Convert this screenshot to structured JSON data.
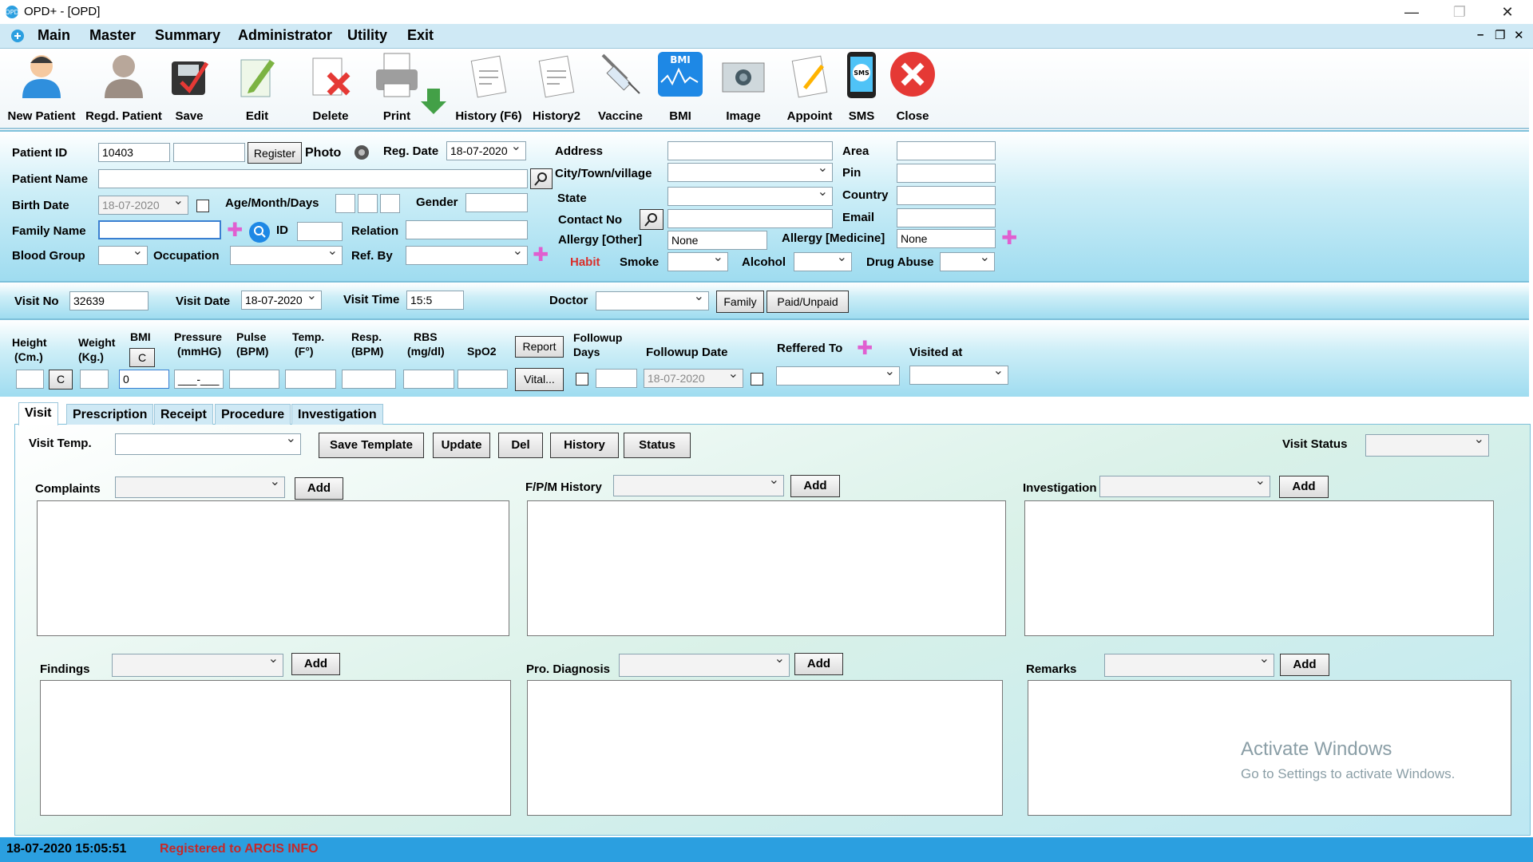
{
  "window": {
    "title": "OPD+ - [OPD]"
  },
  "menu": [
    "Main",
    "Master",
    "Summary",
    "Administrator",
    "Utility",
    "Exit"
  ],
  "toolbar": [
    {
      "label": "New Patient",
      "icon": "new-patient-icon"
    },
    {
      "label": "Regd. Patient",
      "icon": "registered-patient-icon"
    },
    {
      "label": "Save",
      "icon": "save-icon"
    },
    {
      "label": "Edit",
      "icon": "edit-icon"
    },
    {
      "label": "Delete",
      "icon": "delete-icon"
    },
    {
      "label": "Print",
      "icon": "print-icon"
    },
    {
      "label": "History (F6)",
      "icon": "history-icon"
    },
    {
      "label": "History2",
      "icon": "history2-icon"
    },
    {
      "label": "Vaccine",
      "icon": "vaccine-icon"
    },
    {
      "label": "BMI",
      "icon": "bmi-icon"
    },
    {
      "label": "Image",
      "icon": "image-icon"
    },
    {
      "label": "Appoint",
      "icon": "appointment-icon"
    },
    {
      "label": "SMS",
      "icon": "sms-icon"
    },
    {
      "label": "Close",
      "icon": "close-icon"
    }
  ],
  "patient": {
    "patient_id_label": "Patient ID",
    "patient_id": "10403",
    "register_btn": "Register",
    "photo_label": "Photo",
    "reg_date_label": "Reg. Date",
    "reg_date": "18-07-2020",
    "name_label": "Patient Name",
    "birth_label": "Birth Date",
    "birth_date": "18-07-2020",
    "age_label": "Age/Month/Days",
    "gender_label": "Gender",
    "family_label": "Family Name",
    "id_label": "ID",
    "relation_label": "Relation",
    "blood_label": "Blood Group",
    "occupation_label": "Occupation",
    "refby_label": "Ref. By",
    "address_label": "Address",
    "city_label": "City/Town/village",
    "state_label": "State",
    "contact_label": "Contact No",
    "allergy_other_label": "Allergy [Other]",
    "allergy_other": "None",
    "allergy_med_label": "Allergy [Medicine]",
    "allergy_med": "None",
    "habit_label": "Habit",
    "smoke_label": "Smoke",
    "alcohol_label": "Alcohol",
    "drug_label": "Drug Abuse",
    "area_label": "Area",
    "pin_label": "Pin",
    "country_label": "Country",
    "email_label": "Email"
  },
  "visit": {
    "visit_no_label": "Visit No",
    "visit_no": "32639",
    "visit_date_label": "Visit Date",
    "visit_date": "18-07-2020",
    "visit_time_label": "Visit Time",
    "visit_time": "15:5",
    "doctor_label": "Doctor",
    "family_btn": "Family",
    "paid_btn": "Paid/Unpaid"
  },
  "vitals": {
    "height_l1": "Height",
    "height_l2": "(Cm.)",
    "weight_l1": "Weight",
    "weight_l2": "(Kg.)",
    "bmi_label": "BMI",
    "c_btn": "C",
    "bmi_value": "0",
    "pressure_l1": "Pressure",
    "pressure_l2": "(mmHG)",
    "pressure_mask": "___-___",
    "pulse_l1": "Pulse",
    "pulse_l2": "(BPM)",
    "temp_l1": "Temp.",
    "temp_l2": "(F°)",
    "resp_l1": "Resp.",
    "resp_l2": "(BPM)",
    "rbs_l1": "RBS",
    "rbs_l2": "(mg/dl)",
    "spo2_label": "SpO2",
    "report_btn": "Report",
    "vital_btn": "Vital...",
    "followup_l1": "Followup",
    "followup_l2": "Days",
    "followup_date_label": "Followup Date",
    "followup_date": "18-07-2020",
    "referred_label": "Reffered To",
    "visited_label": "Visited at"
  },
  "tabs": [
    "Visit",
    "Prescription",
    "Receipt",
    "Procedure",
    "Investigation"
  ],
  "visit_tab": {
    "template_label": "Visit Temp.",
    "save_template": "Save Template",
    "update": "Update",
    "del": "Del",
    "history": "History",
    "status": "Status",
    "visit_status_label": "Visit Status",
    "complaints": "Complaints",
    "fpm": "F/P/M History",
    "investigation": "Investigation",
    "findings": "Findings",
    "diagnosis": "Pro. Diagnosis",
    "remarks": "Remarks",
    "add": "Add"
  },
  "watermark": {
    "line1": "Activate Windows",
    "line2": "Go to Settings to activate Windows."
  },
  "status": {
    "datetime": "18-07-2020 15:05:51",
    "registered": "Registered to ARCIS INFO"
  }
}
